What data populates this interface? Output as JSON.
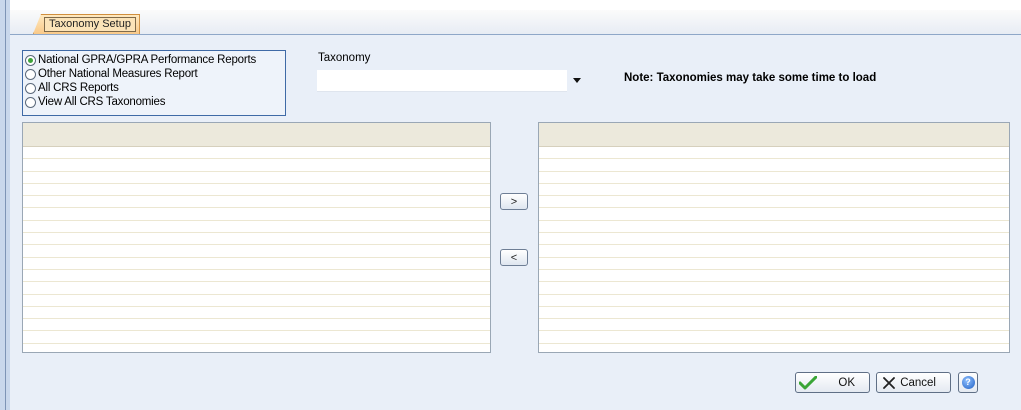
{
  "tab": {
    "label": "Taxonomy Setup"
  },
  "report_options": [
    {
      "label": "National GPRA/GPRA Performance Reports",
      "checked": true
    },
    {
      "label": "Other National Measures Report",
      "checked": false
    },
    {
      "label": "All CRS Reports",
      "checked": false
    },
    {
      "label": "View All CRS Taxonomies",
      "checked": false
    }
  ],
  "taxonomy": {
    "label": "Taxonomy",
    "value": ""
  },
  "note": "Note:  Taxonomies may take some time to load",
  "move_buttons": {
    "add": ">",
    "remove": "<"
  },
  "buttons": {
    "ok": "OK",
    "cancel": "Cancel"
  },
  "icons": {
    "ok": "check-icon",
    "cancel": "x-icon",
    "help": "help-icon",
    "dropdown": "chevron-down-icon"
  },
  "colors": {
    "tab_fill": "#f9c989",
    "panel": "#e9eff8",
    "list_header": "#ece9dc",
    "radio_selected": "#3da33a"
  }
}
